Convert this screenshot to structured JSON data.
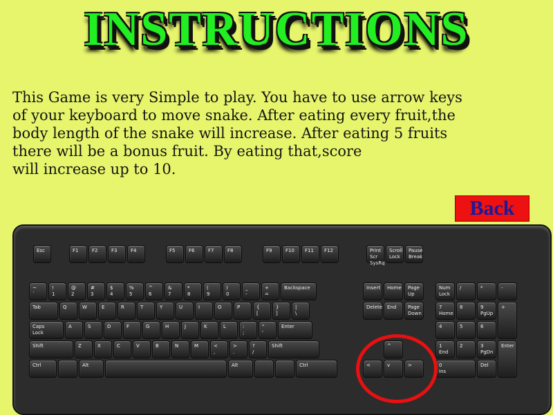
{
  "title": "INSTRUCTIONS",
  "instructions": [
    "This Game is very Simple to play. You have to use arrow keys",
    "of your keyboard to move snake. After eating every fruit,the",
    "body length of the snake will increase. After eating 5 fruits",
    "there will be a bonus fruit. By eating that,score",
    "will increase up to 10."
  ],
  "back_label": "Back",
  "keyboard": {
    "esc": "Esc",
    "f": [
      "F1",
      "F2",
      "F3",
      "F4",
      "F5",
      "F6",
      "F7",
      "F8",
      "F9",
      "F10",
      "F11",
      "F12"
    ],
    "sys": [
      "Print Scr SysRq",
      "Scroll Lock",
      "Pause Break"
    ],
    "num_row": [
      "~ `",
      "! 1",
      "@ 2",
      "# 3",
      "$ 4",
      "% 5",
      "^ 6",
      "& 7",
      "* 8",
      "( 9",
      ") 0",
      "_ -",
      "+ ="
    ],
    "backspace": "Backspace",
    "tab": "Tab",
    "q_row": [
      "Q",
      "W",
      "E",
      "R",
      "T",
      "Y",
      "U",
      "I",
      "O",
      "P",
      "{ [",
      "} ]",
      "| \\"
    ],
    "caps": "Caps Lock",
    "a_row": [
      "A",
      "S",
      "D",
      "F",
      "G",
      "H",
      "J",
      "K",
      "L",
      ": ;",
      "\" '"
    ],
    "enter": "Enter",
    "shift": "Shift",
    "z_row": [
      "Z",
      "X",
      "C",
      "V",
      "B",
      "N",
      "M",
      "< ,",
      "> .",
      "? /"
    ],
    "ctrl": "Ctrl",
    "alt": "Alt",
    "nav": [
      "Insert",
      "Home",
      "Page Up",
      "Delete",
      "End",
      "Page Down"
    ],
    "arrows": [
      "^",
      "<",
      "v",
      ">"
    ],
    "numpad": [
      "Num Lock",
      "/",
      "*",
      "-",
      "7 Home",
      "8",
      "9 PgUp",
      "+",
      "4",
      "5",
      "6",
      "1 End",
      "2",
      "3 PgDn",
      "Enter",
      "0 Ins",
      "Del"
    ]
  }
}
